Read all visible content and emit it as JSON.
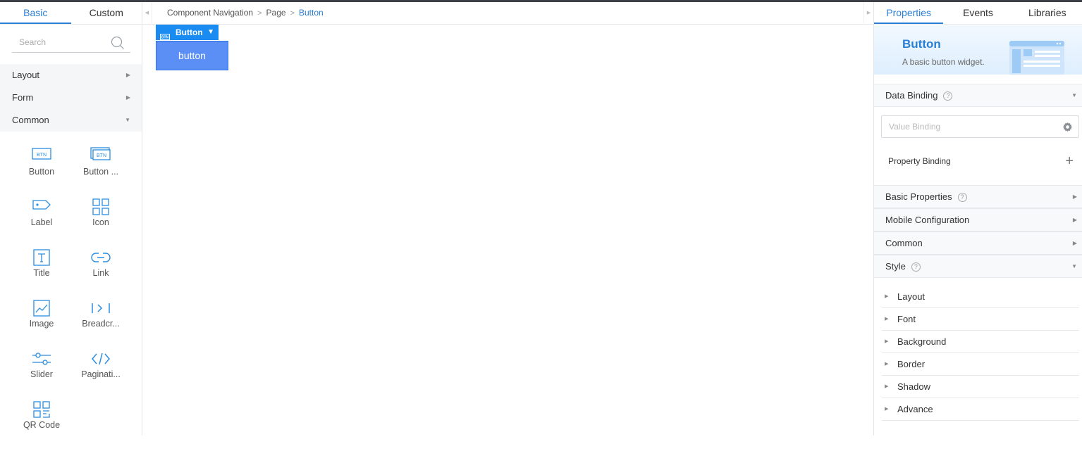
{
  "left_panel": {
    "tabs": [
      {
        "label": "Basic",
        "active": true
      },
      {
        "label": "Custom",
        "active": false
      }
    ],
    "search": {
      "placeholder": "Search"
    },
    "categories": [
      {
        "label": "Layout",
        "state": "collapsed"
      },
      {
        "label": "Form",
        "state": "collapsed"
      },
      {
        "label": "Common",
        "state": "expanded"
      }
    ],
    "widgets": [
      {
        "label": "Button",
        "icon": "button-icon"
      },
      {
        "label": "Button ...",
        "icon": "button-group-icon"
      },
      {
        "label": "Label",
        "icon": "label-tag-icon"
      },
      {
        "label": "Icon",
        "icon": "grid-icon"
      },
      {
        "label": "Title",
        "icon": "title-icon"
      },
      {
        "label": "Link",
        "icon": "link-icon"
      },
      {
        "label": "Image",
        "icon": "image-icon"
      },
      {
        "label": "Breadcr...",
        "icon": "breadcrumb-icon"
      },
      {
        "label": "Slider",
        "icon": "slider-icon"
      },
      {
        "label": "Paginati...",
        "icon": "pagination-icon"
      },
      {
        "label": "QR Code",
        "icon": "qr-code-icon"
      }
    ]
  },
  "breadcrumb": {
    "items": [
      "Component Navigation",
      "Page"
    ],
    "current": "Button"
  },
  "canvas": {
    "selection_label": "Button",
    "button_text": "button"
  },
  "right_panel": {
    "tabs": [
      {
        "label": "Properties",
        "active": true
      },
      {
        "label": "Events",
        "active": false
      },
      {
        "label": "Libraries",
        "active": false
      }
    ],
    "banner": {
      "title": "Button",
      "description": "A basic button widget."
    },
    "sections": {
      "data_binding": "Data Binding",
      "value_binding_placeholder": "Value Binding",
      "property_binding": "Property Binding",
      "basic_properties": "Basic Properties",
      "mobile_configuration": "Mobile Configuration",
      "common": "Common",
      "style": "Style"
    },
    "style_items": [
      "Layout",
      "Font",
      "Background",
      "Border",
      "Shadow",
      "Advance"
    ]
  },
  "colors": {
    "accent": "#2a7fd4",
    "selection": "#1a8bf0",
    "button_fill": "#5b8ff5"
  }
}
